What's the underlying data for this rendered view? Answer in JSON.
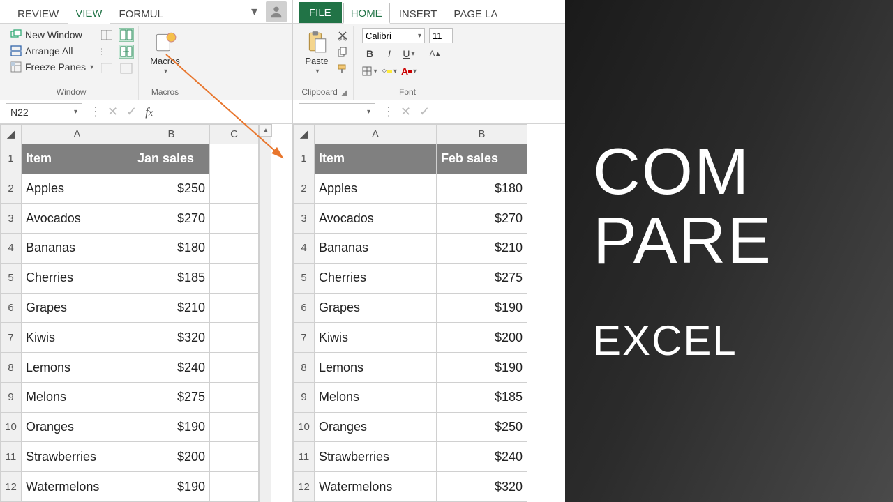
{
  "leftPane": {
    "tabs": [
      "REVIEW",
      "VIEW",
      "FORMUL"
    ],
    "activeTab": "VIEW",
    "ribbon": {
      "windowGroup": {
        "label": "Window",
        "newWindow": "New Window",
        "arrangeAll": "Arrange All",
        "freezePanes": "Freeze Panes"
      },
      "macrosGroup": {
        "label": "Macros",
        "macros": "Macros"
      }
    },
    "nameBox": "N22",
    "headers": {
      "item": "Item",
      "sales": "Jan sales"
    },
    "cols": [
      "A",
      "B",
      "C"
    ],
    "rows": [
      {
        "n": "1"
      },
      {
        "n": "2",
        "item": "Apples",
        "val": "$250"
      },
      {
        "n": "3",
        "item": "Avocados",
        "val": "$270"
      },
      {
        "n": "4",
        "item": "Bananas",
        "val": "$180"
      },
      {
        "n": "5",
        "item": "Cherries",
        "val": "$185"
      },
      {
        "n": "6",
        "item": "Grapes",
        "val": "$210"
      },
      {
        "n": "7",
        "item": "Kiwis",
        "val": "$320"
      },
      {
        "n": "8",
        "item": "Lemons",
        "val": "$240"
      },
      {
        "n": "9",
        "item": "Melons",
        "val": "$275"
      },
      {
        "n": "10",
        "item": "Oranges",
        "val": "$190"
      },
      {
        "n": "11",
        "item": "Strawberries",
        "val": "$200"
      },
      {
        "n": "12",
        "item": "Watermelons",
        "val": "$190"
      }
    ]
  },
  "rightPane": {
    "tabs": [
      "FILE",
      "HOME",
      "INSERT",
      "PAGE LA"
    ],
    "activeTab": "HOME",
    "ribbon": {
      "clipboardGroup": {
        "label": "Clipboard",
        "paste": "Paste"
      },
      "fontGroup": {
        "label": "Font",
        "fontName": "Calibri",
        "fontSize": "11"
      }
    },
    "nameBox": "",
    "headers": {
      "item": "Item",
      "sales": "Feb sales"
    },
    "cols": [
      "A",
      "B"
    ],
    "rows": [
      {
        "n": "1"
      },
      {
        "n": "2",
        "item": "Apples",
        "val": "$180"
      },
      {
        "n": "3",
        "item": "Avocados",
        "val": "$270"
      },
      {
        "n": "4",
        "item": "Bananas",
        "val": "$210"
      },
      {
        "n": "5",
        "item": "Cherries",
        "val": "$275"
      },
      {
        "n": "6",
        "item": "Grapes",
        "val": "$190"
      },
      {
        "n": "7",
        "item": "Kiwis",
        "val": "$200"
      },
      {
        "n": "8",
        "item": "Lemons",
        "val": "$190"
      },
      {
        "n": "9",
        "item": "Melons",
        "val": "$185"
      },
      {
        "n": "10",
        "item": "Oranges",
        "val": "$250"
      },
      {
        "n": "11",
        "item": "Strawberries",
        "val": "$240"
      },
      {
        "n": "12",
        "item": "Watermelons",
        "val": "$320"
      }
    ]
  },
  "banner": {
    "line1": "COM",
    "line2": "PARE",
    "sub": "EXCEL"
  }
}
